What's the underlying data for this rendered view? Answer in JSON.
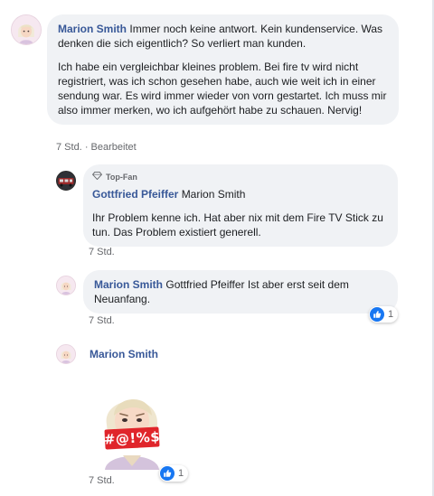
{
  "comments": [
    {
      "author": "Marion Smith",
      "paragraph1": "Immer noch keine antwort. Kein kundenservice. Was denken die sich eigentlich? So verliert man kunden.",
      "paragraph2": "Ich habe ein vergleichbar kleines problem. Bei fire tv wird nicht registriert, was ich schon gesehen habe, auch wie weit ich in einer sendung war. Es wird immer wieder von vorn gestartet. Ich muss mir also immer merken, wo ich aufgehört habe zu schauen. Nervig!",
      "time": "7 Std.",
      "separator": "·",
      "edited": "Bearbeitet"
    }
  ],
  "replies": [
    {
      "badge_icon": "diamond-icon",
      "badge": "Top-Fan",
      "author": "Gottfried Pfeiffer",
      "mention": "Marion Smith",
      "text": "Ihr Problem kenne ich. Hat aber nix mit dem Fire TV Stick zu tun. Das Problem existiert generell.",
      "time": "7 Std."
    },
    {
      "author": "Marion Smith",
      "mention": "Gottfried Pfeiffer",
      "text": "Ist aber erst seit dem Neuanfang.",
      "time": "7 Std.",
      "reaction_icon": "thumbs-up-icon",
      "reaction_count": "1"
    },
    {
      "author": "Marion Smith",
      "sticker_text": "#@!%$",
      "time": "7 Std.",
      "reaction_icon": "thumbs-up-icon",
      "reaction_count": "1"
    }
  ],
  "colors": {
    "author": "#385898",
    "bubble": "#f0f2f5",
    "like": "#1877f2",
    "meta": "#65676b"
  }
}
